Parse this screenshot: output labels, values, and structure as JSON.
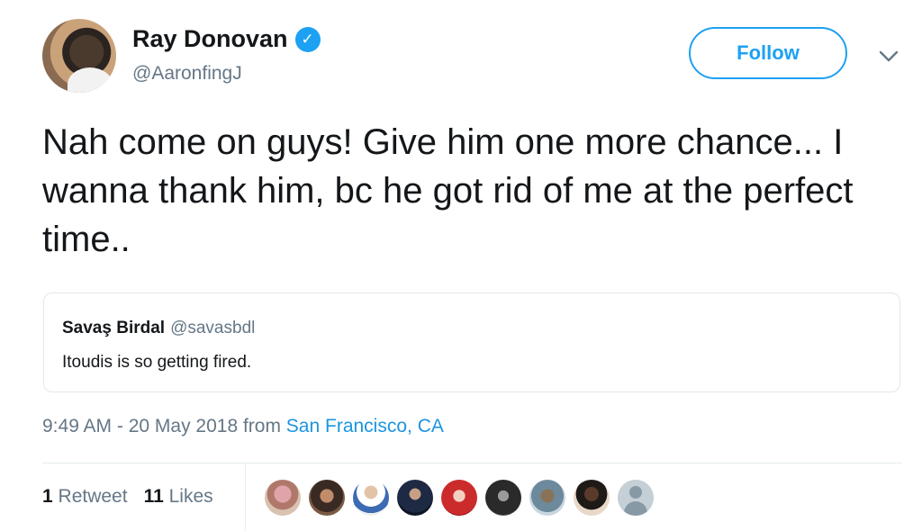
{
  "author": {
    "display_name": "Ray Donovan",
    "handle": "@AaronfingJ",
    "verified_icon": "verified-badge-icon"
  },
  "actions": {
    "follow_label": "Follow",
    "more_icon": "chevron-down-icon"
  },
  "tweet": {
    "text": "Nah come on guys! Give him one more chance... I wanna thank him, bc he got rid of me at the perfect time.."
  },
  "quote": {
    "name": "Savaş Birdal",
    "handle": "@savasbdl",
    "text": "Itoudis is so getting fired."
  },
  "meta": {
    "time_date": "9:49 AM - 20 May 2018 from ",
    "location": "San Francisco, CA"
  },
  "stats": {
    "retweets_count": "1",
    "retweets_label": "Retweet",
    "likes_count": "11",
    "likes_label": "Likes"
  },
  "colors": {
    "accent": "#1da1f2",
    "link": "#1b95e0",
    "secondary_text": "#657786",
    "border": "#e1e8ed"
  }
}
